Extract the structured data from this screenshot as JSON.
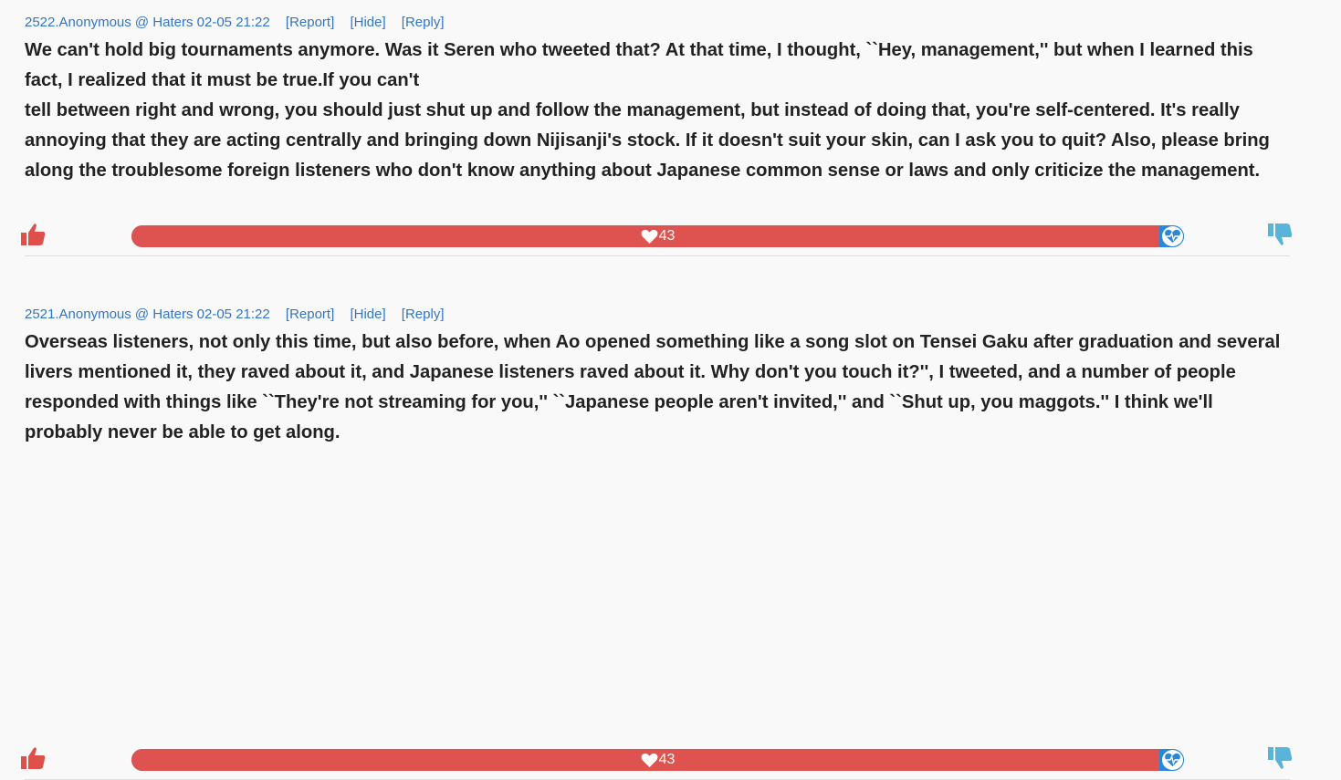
{
  "posts": [
    {
      "header": "2522.Anonymous @ Haters 02-05 21:22",
      "report_label": "[Report]",
      "hide_label": "[Hide]",
      "reply_label": "[Reply]",
      "body_line1": "We can't hold big tournaments anymore. Was it Seren who tweeted that? At that time, I thought, ``Hey, management,'' but when I learned this fact, I realized that it must be true.If you can't",
      "body_line2": "tell between right and wrong, you should just shut up and follow the management, but instead of doing that, you're self-centered. It's really annoying that they are acting centrally and bringing down Nijisanji's stock. If it doesn't suit your skin, can I ask you to quit? Also, please bring along the troublesome foreign listeners who don't know anything about Japanese common sense or laws and only criticize the management.",
      "good_count": "43",
      "good_ratio": 0.977
    },
    {
      "header": "2521.Anonymous @ Haters 02-05 21:22",
      "report_label": "[Report]",
      "hide_label": "[Hide]",
      "reply_label": "[Reply]",
      "body_line1": "Overseas listeners, not only this time, but also before, when Ao opened something like a song slot on Tensei Gaku after graduation and several livers mentioned it, they raved about it, and Japanese listeners raved about it. Why don't you touch it?'', I tweeted, and a number of people responded with things like ``They're not streaming for you,'' ``Japanese people aren't invited,'' and ``Shut up, you maggots.'' I think we'll probably never be able to get along.",
      "body_line2": "",
      "good_count": "43",
      "good_ratio": 0.977
    }
  ],
  "colors": {
    "link": "#3275c8",
    "good": "#de524f",
    "bad": "#2b87d8",
    "thumb_up": "#e0504b",
    "thumb_down": "#5ab4da"
  },
  "icons": {
    "up": "thumbs-up-icon",
    "down": "thumbs-down-icon",
    "heart": "heart-icon",
    "bad": "heartbeat-icon"
  }
}
